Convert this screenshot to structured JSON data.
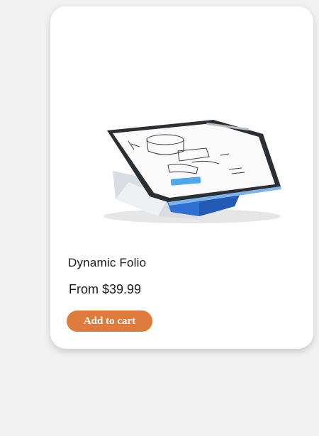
{
  "product": {
    "title": "Dynamic Folio",
    "price": "From $39.99",
    "add_to_cart_label": "Add to cart",
    "accent_color": "#e07b3e",
    "image_icon": "tablet-on-folio-stand"
  }
}
